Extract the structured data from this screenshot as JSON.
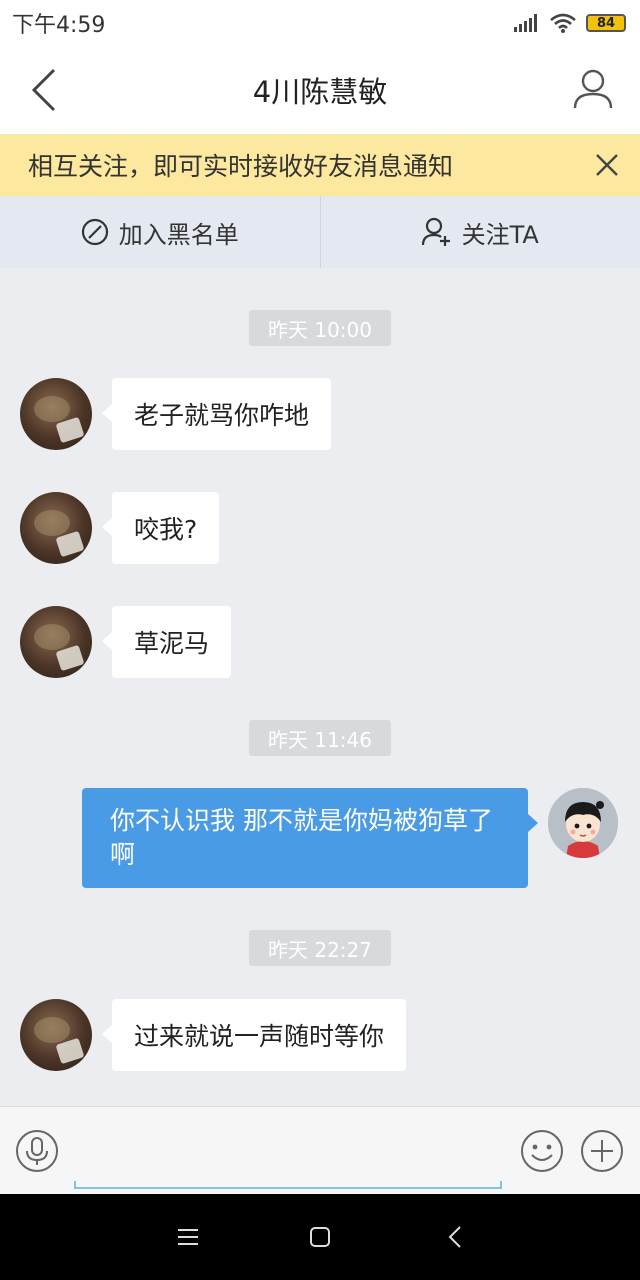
{
  "status_bar": {
    "time": "下午4:59",
    "battery": "84"
  },
  "header": {
    "title": "4川陈慧敏"
  },
  "notice": {
    "text": "相互关注，即可实时接收好友消息通知"
  },
  "actions": {
    "block_label": "加入黑名单",
    "follow_label": "关注TA"
  },
  "messages": [
    {
      "type": "time",
      "text": "昨天 10:00"
    },
    {
      "type": "incoming",
      "text": "老子就骂你咋地"
    },
    {
      "type": "incoming",
      "text": "咬我?"
    },
    {
      "type": "incoming",
      "text": "草泥马"
    },
    {
      "type": "time",
      "text": "昨天 11:46"
    },
    {
      "type": "outgoing",
      "text": "你不认识我  那不就是你妈被狗草了啊"
    },
    {
      "type": "time",
      "text": "昨天 22:27"
    },
    {
      "type": "incoming",
      "text": "过来就说一声随时等你"
    }
  ],
  "input_bar": {
    "message_value": ""
  },
  "colors": {
    "accent_blue": "#4a9be6",
    "notice_yellow": "#fce89e",
    "battery_yellow": "#f2c20c"
  },
  "icons": [
    "signal-icon",
    "wifi-icon",
    "battery-icon",
    "back-arrow-icon",
    "profile-icon",
    "close-icon",
    "block-icon",
    "follow-user-icon",
    "voice-icon",
    "emoji-icon",
    "plus-icon",
    "menu-icon",
    "home-icon",
    "back-nav-icon"
  ]
}
